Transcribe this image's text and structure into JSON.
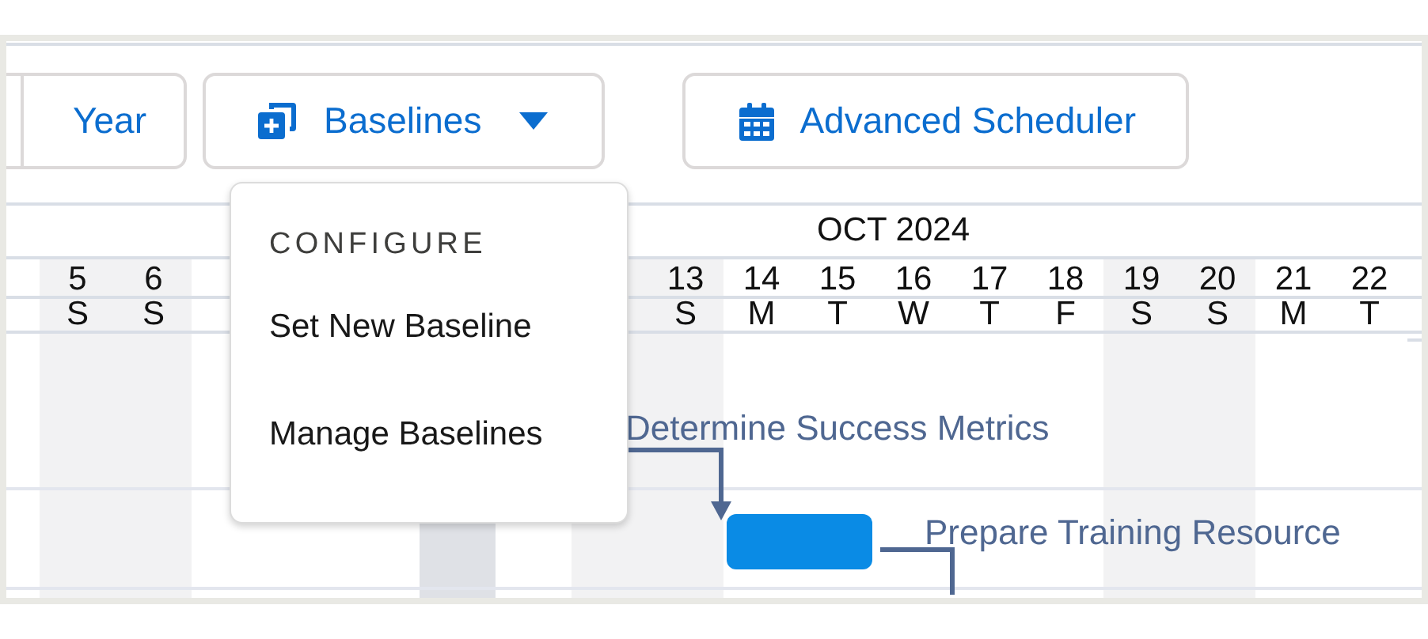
{
  "toolbar": {
    "view_segment": {
      "label": "Year"
    },
    "baselines_button": {
      "label": "Baselines",
      "expanded": true
    },
    "scheduler_button": {
      "label": "Advanced Scheduler"
    }
  },
  "baselines_menu": {
    "heading": "CONFIGURE",
    "items": [
      {
        "label": "Set New Baseline"
      },
      {
        "label": "Manage Baselines"
      }
    ]
  },
  "timeline": {
    "month": "OCT 2024",
    "days": [
      {
        "date": "5",
        "weekday": "S",
        "weekend": true,
        "today": false
      },
      {
        "date": "6",
        "weekday": "S",
        "weekend": true,
        "today": false
      },
      {
        "weekend": false,
        "today": false
      },
      {
        "weekend": false,
        "today": false
      },
      {
        "weekend": false,
        "today": false
      },
      {
        "weekend": false,
        "today": true
      },
      {
        "weekend": false,
        "today": false
      },
      {
        "weekend": true,
        "today": false
      },
      {
        "date": "13",
        "weekday": "S",
        "weekend": true,
        "today": false
      },
      {
        "date": "14",
        "weekday": "M",
        "weekend": false,
        "today": false
      },
      {
        "date": "15",
        "weekday": "T",
        "weekend": false,
        "today": false
      },
      {
        "date": "16",
        "weekday": "W",
        "weekend": false,
        "today": false
      },
      {
        "date": "17",
        "weekday": "T",
        "weekend": false,
        "today": false
      },
      {
        "date": "18",
        "weekday": "F",
        "weekend": false,
        "today": false
      },
      {
        "date": "19",
        "weekday": "S",
        "weekend": true,
        "today": false
      },
      {
        "date": "20",
        "weekday": "S",
        "weekend": true,
        "today": false
      },
      {
        "date": "21",
        "weekday": "M",
        "weekend": false,
        "today": false
      },
      {
        "date": "22",
        "weekday": "T",
        "weekend": false,
        "today": false
      }
    ],
    "tasks": [
      {
        "name": "Determine Success Metrics"
      },
      {
        "name": "Prepare Training Resource"
      }
    ]
  }
}
